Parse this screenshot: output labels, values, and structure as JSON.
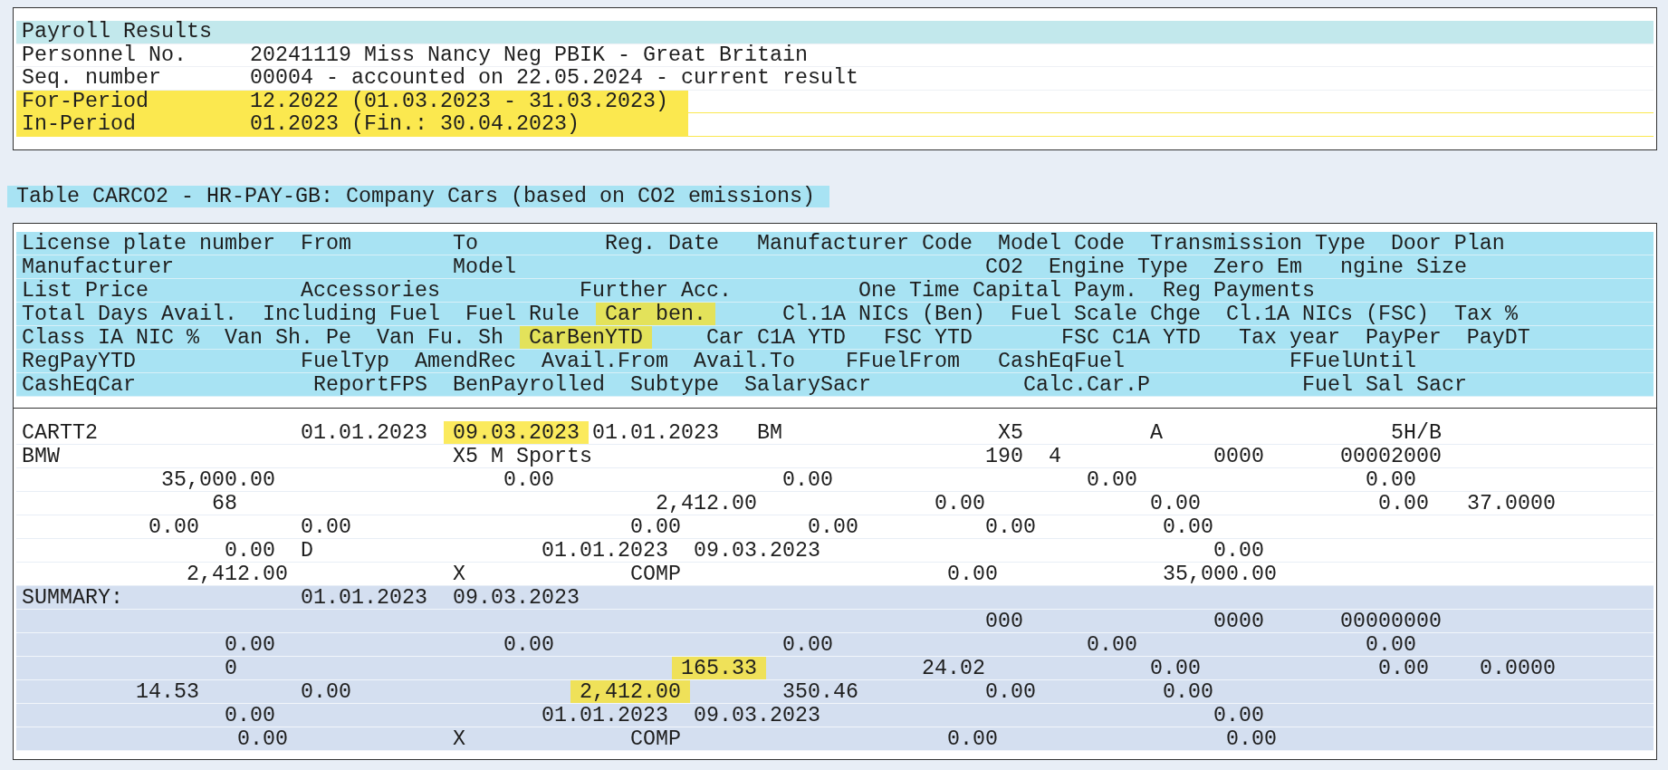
{
  "payroll_results": {
    "title": "Payroll Results",
    "rows": [
      {
        "label": "Personnel No.",
        "value": "20241119 Miss Nancy Neg PBIK - Great Britain",
        "highlighted": false
      },
      {
        "label": "Seq. number",
        "value": "00004 - accounted on 22.05.2024 - current result",
        "highlighted": false
      },
      {
        "label": "For-Period",
        "value": "12.2022 (01.03.2023 - 31.03.2023)",
        "highlighted": true
      },
      {
        "label": "In-Period",
        "value": "01.2023 (Fin.: 30.04.2023)",
        "highlighted": true
      }
    ]
  },
  "table": {
    "title": "Table CARCO2 - HR-PAY-GB: Company Cars (based on CO2 emissions)",
    "header_lines": [
      [
        {
          "text": "License plate number",
          "highlighted": false
        },
        {
          "text": "From",
          "highlighted": false
        },
        {
          "text": "To",
          "highlighted": false
        },
        {
          "text": "Reg. Date",
          "highlighted": false
        },
        {
          "text": "Manufacturer Code",
          "highlighted": false
        },
        {
          "text": "Model Code",
          "highlighted": false
        },
        {
          "text": "Transmission Type",
          "highlighted": false
        },
        {
          "text": "Door Plan",
          "highlighted": false
        }
      ],
      [
        {
          "text": "Manufacturer",
          "highlighted": false
        },
        {
          "text": "Model",
          "highlighted": false
        },
        {
          "text": "CO2",
          "highlighted": false
        },
        {
          "text": "Engine Type",
          "highlighted": false
        },
        {
          "text": "Zero Em",
          "highlighted": false
        },
        {
          "text": "ngine Size",
          "highlighted": false
        }
      ],
      [
        {
          "text": "List Price",
          "highlighted": false
        },
        {
          "text": "Accessories",
          "highlighted": false
        },
        {
          "text": "Further Acc.",
          "highlighted": false
        },
        {
          "text": "One Time Capital Paym.",
          "highlighted": false
        },
        {
          "text": "Reg Payments",
          "highlighted": false
        }
      ],
      [
        {
          "text": "Total Days Avail.",
          "highlighted": false
        },
        {
          "text": "Including Fuel",
          "highlighted": false
        },
        {
          "text": "Fuel Rule",
          "highlighted": false
        },
        {
          "text": "Car ben.",
          "highlighted": true
        },
        {
          "text": "Cl.1A NICs (Ben)",
          "highlighted": false
        },
        {
          "text": "Fuel Scale Chge",
          "highlighted": false
        },
        {
          "text": "Cl.1A NICs (FSC)",
          "highlighted": false
        },
        {
          "text": "Tax %",
          "highlighted": false
        }
      ],
      [
        {
          "text": "Class IA NIC %",
          "highlighted": false
        },
        {
          "text": "Van Sh. Pe",
          "highlighted": false
        },
        {
          "text": "Van Fu. Sh",
          "highlighted": false
        },
        {
          "text": "CarBenYTD",
          "highlighted": true
        },
        {
          "text": "Car C1A YTD",
          "highlighted": false
        },
        {
          "text": "FSC YTD",
          "highlighted": false
        },
        {
          "text": "FSC C1A YTD",
          "highlighted": false
        },
        {
          "text": "Tax year",
          "highlighted": false
        },
        {
          "text": "PayPer",
          "highlighted": false
        },
        {
          "text": "PayDT",
          "highlighted": false
        }
      ],
      [
        {
          "text": "RegPayYTD",
          "highlighted": false
        },
        {
          "text": "FuelTyp",
          "highlighted": false
        },
        {
          "text": "AmendRec",
          "highlighted": false
        },
        {
          "text": "Avail.From",
          "highlighted": false
        },
        {
          "text": "Avail.To",
          "highlighted": false
        },
        {
          "text": "FFuelFrom",
          "highlighted": false
        },
        {
          "text": "CashEqFuel",
          "highlighted": false
        },
        {
          "text": "FFuelUntil",
          "highlighted": false
        }
      ],
      [
        {
          "text": "CashEqCar",
          "highlighted": false
        },
        {
          "text": "ReportFPS",
          "highlighted": false
        },
        {
          "text": "BenPayrolled",
          "highlighted": false
        },
        {
          "text": "Subtype",
          "highlighted": false
        },
        {
          "text": "SalarySacr",
          "highlighted": false
        },
        {
          "text": "Calc.Car.P",
          "highlighted": false
        },
        {
          "text": "Fuel Sal Sacr",
          "highlighted": false
        }
      ]
    ],
    "data_lines": [
      [
        {
          "text": "CARTT2",
          "highlighted": false
        },
        {
          "text": "01.01.2023",
          "highlighted": false
        },
        {
          "text": "09.03.2023",
          "highlighted": true
        },
        {
          "text": "01.01.2023",
          "highlighted": false
        },
        {
          "text": "BM",
          "highlighted": false
        },
        {
          "text": "X5",
          "highlighted": false
        },
        {
          "text": "A",
          "highlighted": false
        },
        {
          "text": "5H/B",
          "highlighted": false
        }
      ],
      [
        {
          "text": "BMW",
          "highlighted": false
        },
        {
          "text": "X5 M Sports",
          "highlighted": false
        },
        {
          "text": "190",
          "highlighted": false
        },
        {
          "text": "4",
          "highlighted": false
        },
        {
          "text": "0000",
          "highlighted": false
        },
        {
          "text": "00002000",
          "highlighted": false
        }
      ],
      [
        {
          "text": "35,000.00",
          "highlighted": false
        },
        {
          "text": "0.00",
          "highlighted": false
        },
        {
          "text": "0.00",
          "highlighted": false
        },
        {
          "text": "0.00",
          "highlighted": false
        },
        {
          "text": "0.00",
          "highlighted": false
        }
      ],
      [
        {
          "text": "68",
          "highlighted": false
        },
        {
          "text": "2,412.00",
          "highlighted": false
        },
        {
          "text": "0.00",
          "highlighted": false
        },
        {
          "text": "0.00",
          "highlighted": false
        },
        {
          "text": "0.00",
          "highlighted": false
        },
        {
          "text": "37.0000",
          "highlighted": false
        }
      ],
      [
        {
          "text": "0.00",
          "highlighted": false
        },
        {
          "text": "0.00",
          "highlighted": false
        },
        {
          "text": "0.00",
          "highlighted": false
        },
        {
          "text": "0.00",
          "highlighted": false
        },
        {
          "text": "0.00",
          "highlighted": false
        },
        {
          "text": "0.00",
          "highlighted": false
        }
      ],
      [
        {
          "text": "0.00",
          "highlighted": false
        },
        {
          "text": "D",
          "highlighted": false
        },
        {
          "text": "01.01.2023",
          "highlighted": false
        },
        {
          "text": "09.03.2023",
          "highlighted": false
        },
        {
          "text": "0.00",
          "highlighted": false
        }
      ],
      [
        {
          "text": "2,412.00",
          "highlighted": false
        },
        {
          "text": "X",
          "highlighted": false
        },
        {
          "text": "COMP",
          "highlighted": false
        },
        {
          "text": "0.00",
          "highlighted": false
        },
        {
          "text": "35,000.00",
          "highlighted": false
        }
      ]
    ],
    "summary_lines": [
      [
        {
          "text": "SUMMARY:",
          "highlighted": false
        },
        {
          "text": "01.01.2023",
          "highlighted": false
        },
        {
          "text": "09.03.2023",
          "highlighted": false
        }
      ],
      [
        {
          "text": "000",
          "highlighted": false
        },
        {
          "text": "0000",
          "highlighted": false
        },
        {
          "text": "00000000",
          "highlighted": false
        }
      ],
      [
        {
          "text": "0.00",
          "highlighted": false
        },
        {
          "text": "0.00",
          "highlighted": false
        },
        {
          "text": "0.00",
          "highlighted": false
        },
        {
          "text": "0.00",
          "highlighted": false
        },
        {
          "text": "0.00",
          "highlighted": false
        }
      ],
      [
        {
          "text": "0",
          "highlighted": false
        },
        {
          "text": "165.33",
          "highlighted": true
        },
        {
          "text": "24.02",
          "highlighted": false
        },
        {
          "text": "0.00",
          "highlighted": false
        },
        {
          "text": "0.00",
          "highlighted": false
        },
        {
          "text": "0.0000",
          "highlighted": false
        }
      ],
      [
        {
          "text": "14.53",
          "highlighted": false
        },
        {
          "text": "0.00",
          "highlighted": false
        },
        {
          "text": "2,412.00",
          "highlighted": true
        },
        {
          "text": "350.46",
          "highlighted": false
        },
        {
          "text": "0.00",
          "highlighted": false
        },
        {
          "text": "0.00",
          "highlighted": false
        }
      ],
      [
        {
          "text": "0.00",
          "highlighted": false
        },
        {
          "text": "01.01.2023",
          "highlighted": false
        },
        {
          "text": "09.03.2023",
          "highlighted": false
        },
        {
          "text": "0.00",
          "highlighted": false
        }
      ],
      [
        {
          "text": "0.00",
          "highlighted": false
        },
        {
          "text": "X",
          "highlighted": false
        },
        {
          "text": "COMP",
          "highlighted": false
        },
        {
          "text": "0.00",
          "highlighted": false
        },
        {
          "text": "0.00",
          "highlighted": false
        }
      ]
    ]
  }
}
